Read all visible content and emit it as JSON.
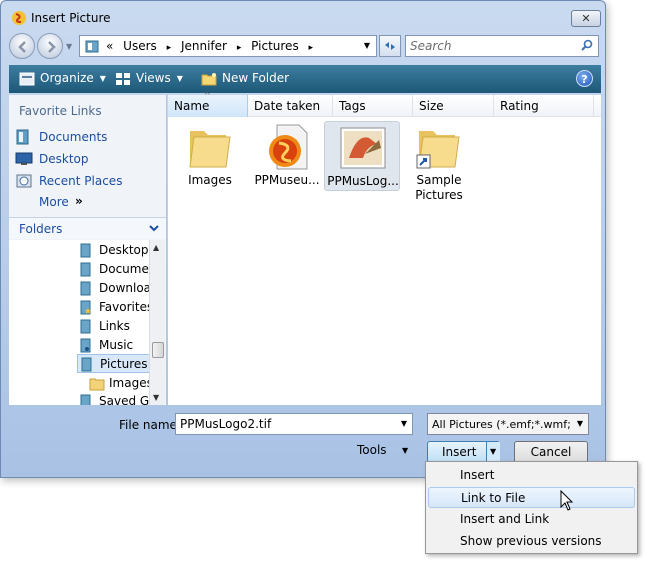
{
  "window": {
    "title": "Insert Picture",
    "close_glyph": "✕"
  },
  "address": {
    "overflow": "«",
    "crumbs": [
      "Users",
      "Jennifer",
      "Pictures"
    ],
    "separator": "▸"
  },
  "search": {
    "placeholder": "Search"
  },
  "toolbar": {
    "organize": "Organize",
    "views": "Views",
    "new_folder": "New Folder",
    "help": "?"
  },
  "favorite_links": {
    "title": "Favorite Links",
    "items": [
      "Documents",
      "Desktop",
      "Recent Places"
    ],
    "more": "More",
    "more_chevron": "»"
  },
  "folders": {
    "label": "Folders",
    "tree": [
      "Desktop",
      "Documents",
      "Downloads",
      "Favorites",
      "Links",
      "Music",
      "Pictures",
      "Images",
      "Saved Games"
    ]
  },
  "columns": [
    "Name",
    "Date taken",
    "Tags",
    "Size",
    "Rating"
  ],
  "files": [
    {
      "label": "Images",
      "icon": "folder-icon"
    },
    {
      "label": "PPMuseu...",
      "icon": "ppmuseum-file-icon"
    },
    {
      "label": "PPMusLog...",
      "icon": "image-thumbnail-icon"
    },
    {
      "label": "Sample Pictures",
      "icon": "folder-shortcut-icon"
    }
  ],
  "footer": {
    "file_name_label": "File name:",
    "file_name_value": "PPMusLogo2.tif",
    "file_type_value": "All Pictures (*.emf;*.wmf;*.jpg;",
    "tools": "Tools",
    "insert": "Insert",
    "cancel": "Cancel"
  },
  "insert_menu": {
    "items": [
      "Insert",
      "Link to File",
      "Insert and Link",
      "Show previous versions"
    ],
    "highlighted_index": 1
  },
  "colors": {
    "toolbar": "#1d5877",
    "link": "#1b4ea0",
    "selection": "#d9e8f8"
  }
}
